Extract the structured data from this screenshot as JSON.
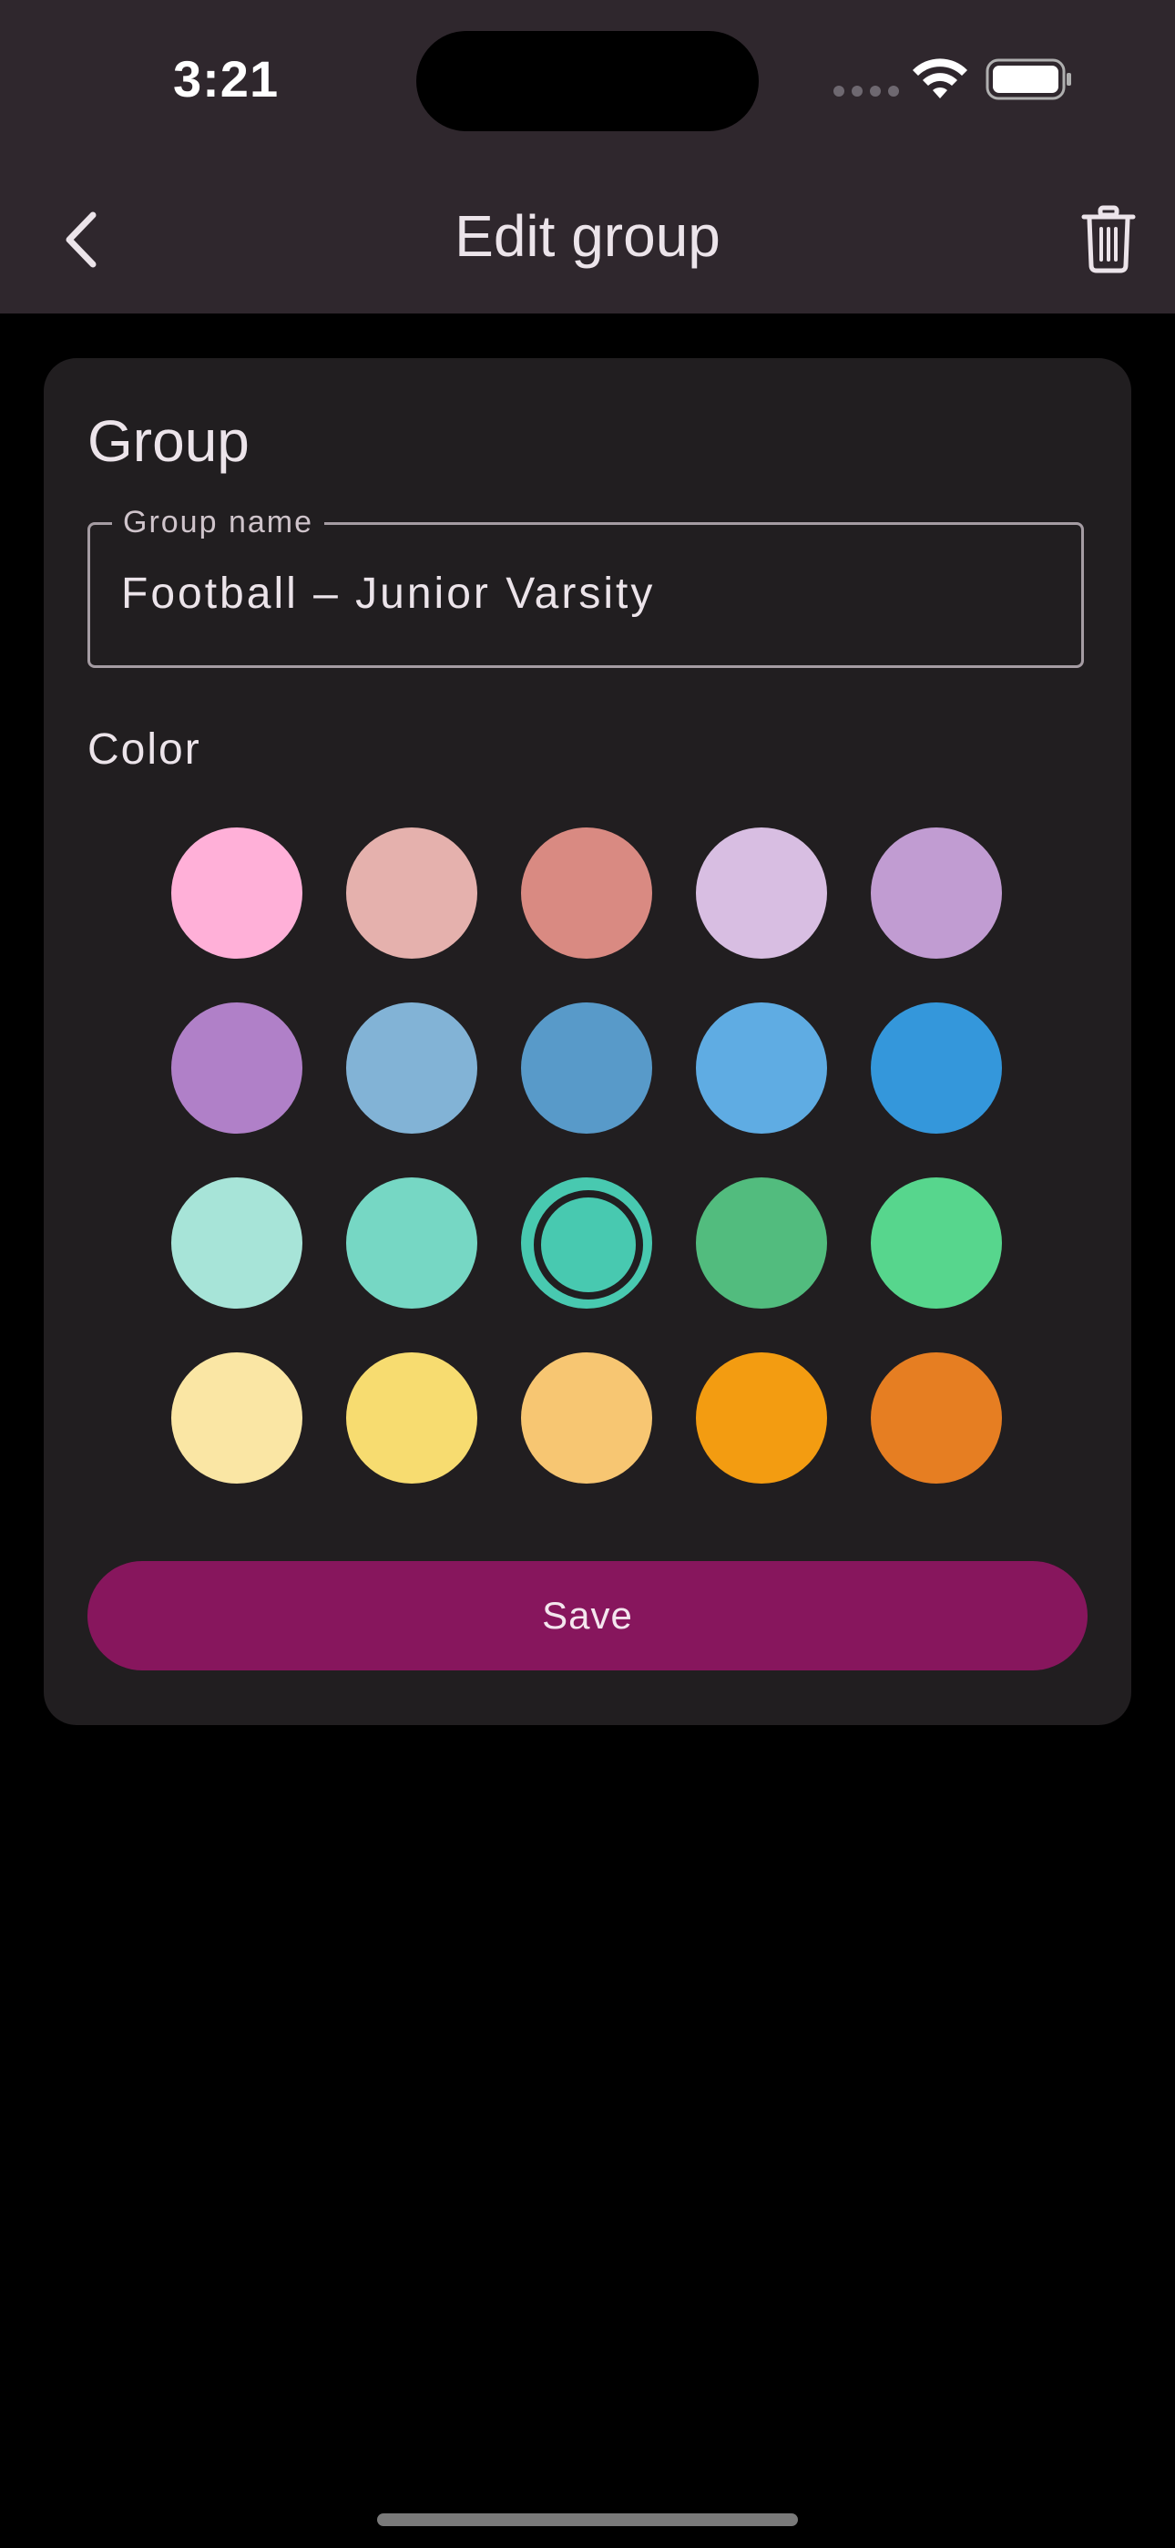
{
  "status_bar": {
    "time": "3:21"
  },
  "app_bar": {
    "title": "Edit group",
    "back_icon": "chevron-left-icon",
    "delete_icon": "trash-icon"
  },
  "card": {
    "section_title": "Group",
    "group_name": {
      "label": "Group name",
      "value": "Football – Junior Varsity"
    },
    "color_label": "Color",
    "swatches": [
      {
        "color": "#FFB0D8",
        "selected": false
      },
      {
        "color": "#E5B1AD",
        "selected": false
      },
      {
        "color": "#D98A82",
        "selected": false
      },
      {
        "color": "#D8BEE2",
        "selected": false
      },
      {
        "color": "#C19CD2",
        "selected": false
      },
      {
        "color": "#B080C8",
        "selected": false
      },
      {
        "color": "#82B3D6",
        "selected": false
      },
      {
        "color": "#589AC9",
        "selected": false
      },
      {
        "color": "#5FACE3",
        "selected": false
      },
      {
        "color": "#3497DB",
        "selected": false
      },
      {
        "color": "#A7E4D8",
        "selected": false
      },
      {
        "color": "#76D7C4",
        "selected": false
      },
      {
        "color": "#48C9B0",
        "selected": true
      },
      {
        "color": "#52BC7E",
        "selected": false
      },
      {
        "color": "#57D68D",
        "selected": false
      },
      {
        "color": "#FAE6A4",
        "selected": false
      },
      {
        "color": "#F7DC70",
        "selected": false
      },
      {
        "color": "#F7C672",
        "selected": false
      },
      {
        "color": "#F39C11",
        "selected": false
      },
      {
        "color": "#E67E22",
        "selected": false
      }
    ],
    "save_label": "Save"
  },
  "colors": {
    "app_bar_bg": "#2F272D",
    "card_bg": "#211E20",
    "accent": "#87165D"
  }
}
